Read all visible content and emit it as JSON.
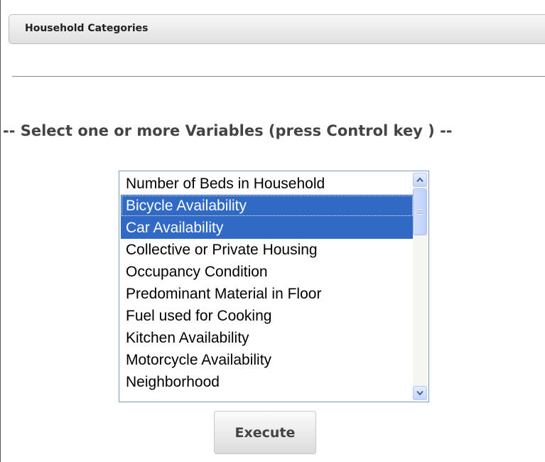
{
  "panel": {
    "title": "Household Categories"
  },
  "instruction": "-- Select one or more Variables (press Control key ) --",
  "variables": {
    "options": [
      {
        "label": "Number of Beds in Household",
        "selected": false
      },
      {
        "label": "Bicycle Availability",
        "selected": true
      },
      {
        "label": "Car Availability",
        "selected": true
      },
      {
        "label": "Collective or Private Housing",
        "selected": false
      },
      {
        "label": "Occupancy Condition",
        "selected": false
      },
      {
        "label": "Predominant Material in Floor",
        "selected": false
      },
      {
        "label": "Fuel used for Cooking",
        "selected": false
      },
      {
        "label": "Kitchen Availability",
        "selected": false
      },
      {
        "label": "Motorcycle Availability",
        "selected": false
      },
      {
        "label": "Neighborhood",
        "selected": false
      }
    ],
    "scroll_icons": [
      "scroll-up-icon",
      "scroll-down-icon"
    ]
  },
  "execute_button": {
    "label": "Execute"
  },
  "colors": {
    "selection": "#316ac5",
    "instruction_text": "#444444",
    "scrollbar_accent": "#c2d3fb"
  }
}
